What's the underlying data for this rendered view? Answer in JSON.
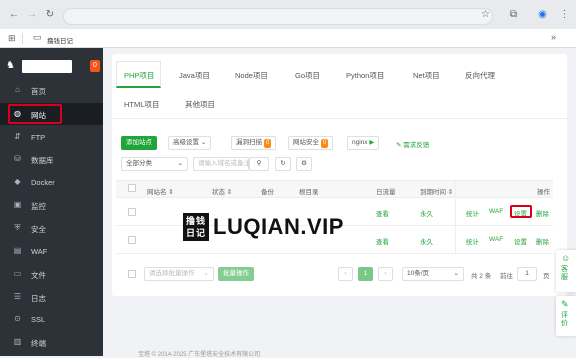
{
  "browser": {
    "bookmark": "撸钱日记",
    "url": ""
  },
  "sidebar": {
    "alert_count": "0",
    "items": [
      {
        "label": "首页",
        "icon": "home-icon"
      },
      {
        "label": "网站",
        "icon": "globe-icon"
      },
      {
        "label": "FTP",
        "icon": "ftp-icon"
      },
      {
        "label": "数据库",
        "icon": "database-icon"
      },
      {
        "label": "Docker",
        "icon": "docker-icon"
      },
      {
        "label": "监控",
        "icon": "monitor-icon"
      },
      {
        "label": "安全",
        "icon": "shield-icon"
      },
      {
        "label": "WAF",
        "icon": "waf-icon"
      },
      {
        "label": "文件",
        "icon": "folder-icon"
      },
      {
        "label": "日志",
        "icon": "log-icon"
      },
      {
        "label": "SSL",
        "icon": "ssl-icon"
      },
      {
        "label": "终端",
        "icon": "terminal-icon"
      }
    ]
  },
  "tabs": [
    "PHP项目",
    "Java项目",
    "Node项目",
    "Go项目",
    "Python项目",
    "Net项目",
    "反向代理",
    "HTML项目",
    "其他项目"
  ],
  "toolbar": {
    "add": "添加站点",
    "settings": "高级设置",
    "scan": "漏洞扫描",
    "scan_count": "0",
    "security": "网站安全",
    "security_count": "0",
    "nginx": "nginx",
    "feedback": "需求反馈",
    "category": "全部分类",
    "search_placeholder": "请输入域名或备注"
  },
  "table": {
    "headers": [
      "网站名",
      "状态",
      "备份",
      "根目录",
      "日流量",
      "到期时间",
      "操作"
    ],
    "rows": [
      {
        "traffic": "查看",
        "expire": "永久",
        "actions": [
          "统计",
          "WAF",
          "设置",
          "删除"
        ]
      },
      {
        "traffic": "查看",
        "expire": "永久",
        "actions": [
          "统计",
          "WAF",
          "设置",
          "删除"
        ]
      }
    ]
  },
  "footer": {
    "batch_placeholder": "请选择批量操作",
    "batch_btn": "批量操作",
    "page": "1",
    "per_page": "10条/页",
    "total": "共 2 条",
    "goto": "前往",
    "goto_val": "1",
    "page_unit": "页"
  },
  "watermark": {
    "text": "LUQIAN.VIP",
    "chars": "撸钱日记"
  },
  "float": {
    "service": "客服",
    "rate": "评价"
  },
  "bottom_text": "宝塔 © 2014-2025 广东堡塔安全技术有限公司"
}
